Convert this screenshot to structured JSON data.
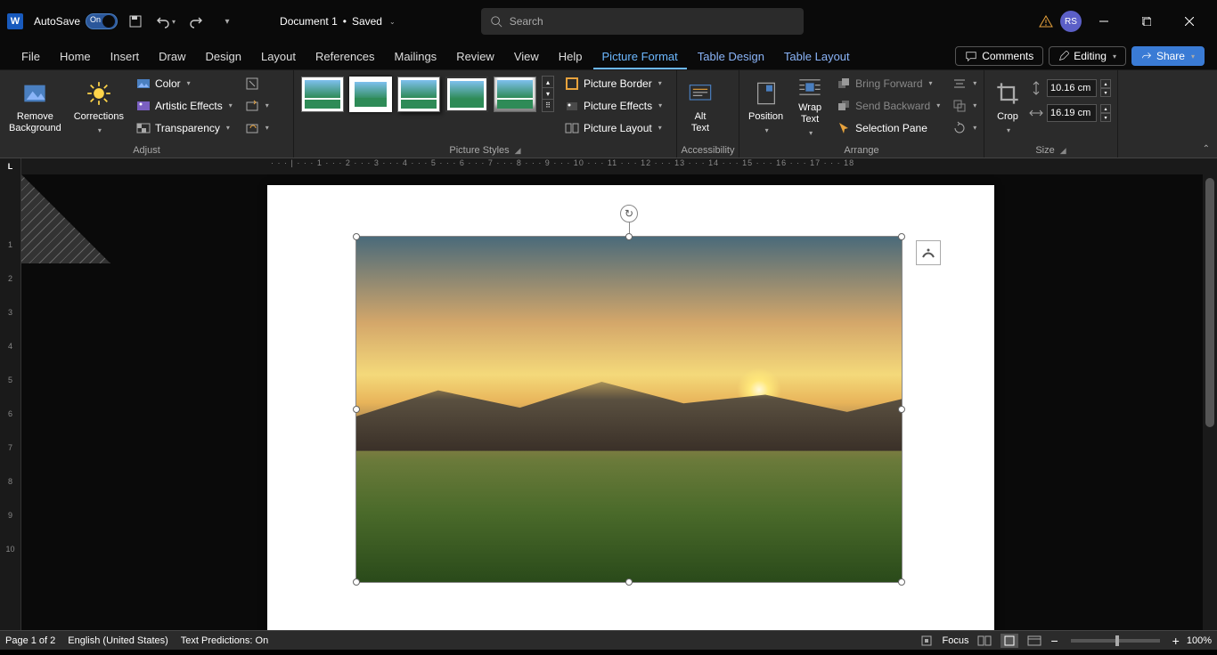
{
  "title": {
    "autosave_label": "AutoSave",
    "autosave_on": "On",
    "document_name": "Document 1",
    "save_status": "Saved",
    "search_placeholder": "Search",
    "user_initials": "RS"
  },
  "tabs": {
    "file": "File",
    "home": "Home",
    "insert": "Insert",
    "draw": "Draw",
    "design": "Design",
    "layout": "Layout",
    "references": "References",
    "mailings": "Mailings",
    "review": "Review",
    "view": "View",
    "help": "Help",
    "picture_format": "Picture Format",
    "table_design": "Table Design",
    "table_layout": "Table Layout",
    "comments": "Comments",
    "editing": "Editing",
    "share": "Share"
  },
  "ribbon": {
    "adjust": {
      "label": "Adjust",
      "remove_bg": "Remove\nBackground",
      "corrections": "Corrections",
      "color": "Color",
      "artistic": "Artistic Effects",
      "transparency": "Transparency"
    },
    "styles": {
      "label": "Picture Styles",
      "border": "Picture Border",
      "effects": "Picture Effects",
      "layout": "Picture Layout"
    },
    "accessibility": {
      "label": "Accessibility",
      "alt_text": "Alt\nText"
    },
    "arrange": {
      "label": "Arrange",
      "position": "Position",
      "wrap": "Wrap\nText",
      "bring_forward": "Bring Forward",
      "send_backward": "Send Backward",
      "selection_pane": "Selection Pane"
    },
    "size": {
      "label": "Size",
      "crop": "Crop",
      "height": "10.16 cm",
      "width": "16.19 cm"
    }
  },
  "status": {
    "page": "Page 1 of 2",
    "language": "English (United States)",
    "predictions": "Text Predictions: On",
    "focus": "Focus",
    "zoom": "100%"
  }
}
